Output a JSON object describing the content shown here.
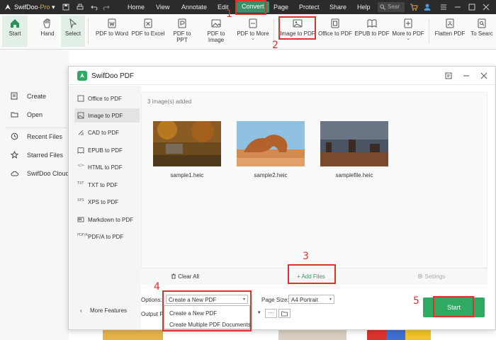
{
  "app": {
    "name": "SwifDoo",
    "edition": "Pro"
  },
  "menu": {
    "items": [
      "Home",
      "View",
      "Annotate",
      "Edit",
      "Convert",
      "Page",
      "Protect",
      "Share",
      "Help"
    ],
    "active": "Convert",
    "search_placeholder": "Sear"
  },
  "ribbon": {
    "items": [
      "Start",
      "Hand",
      "Select",
      "PDF to Word",
      "PDF to Excel",
      "PDF to PPT",
      "PDF to Image",
      "PDF to More",
      "Image to PDF",
      "Office to PDF",
      "EPUB to PDF",
      "More to PDF",
      "Flatten PDF",
      "To Searc"
    ]
  },
  "bg_sidebar": {
    "items": [
      "Create",
      "Open",
      "Recent Files",
      "Starred Files",
      "SwifDoo Cloud"
    ]
  },
  "dialog": {
    "title": "SwifDoo PDF",
    "left_menu": [
      "Office to PDF",
      "Image to PDF",
      "CAD to PDF",
      "EPUB to PDF",
      "HTML to PDF",
      "TXT to PDF",
      "XPS to PDF",
      "Markdown to PDF",
      "PDF/A to PDF"
    ],
    "left_icons": [
      "",
      "",
      "",
      "",
      "</>",
      "TXT",
      "XPS",
      "",
      "PDF/A"
    ],
    "selected": "Image to PDF",
    "more_features": "More Features",
    "count_text": "3 image(s) added",
    "images": [
      {
        "caption": "sample1.heic"
      },
      {
        "caption": "sample2.heic"
      },
      {
        "caption": "samplefile.heic"
      }
    ],
    "actions": {
      "clear_all": "Clear All",
      "add_files": "+ Add Files",
      "settings": "Settings"
    },
    "options_label": "Options:",
    "options_value": "Create a New PDF",
    "options_list": [
      "Create a New PDF",
      "Create Multiple PDF Documents"
    ],
    "page_size_label": "Page Size:",
    "page_size_value": "A4 Portrait",
    "output_label": "Output Pat",
    "browse_label": "···",
    "start_label": "Start"
  },
  "annotations": [
    "1",
    "2",
    "3",
    "4",
    "5"
  ],
  "colors": {
    "accent": "#2eaa62",
    "menu_active": "#3b8f66",
    "annotation": "#e0322d",
    "titlebar": "#2b2b2b"
  }
}
